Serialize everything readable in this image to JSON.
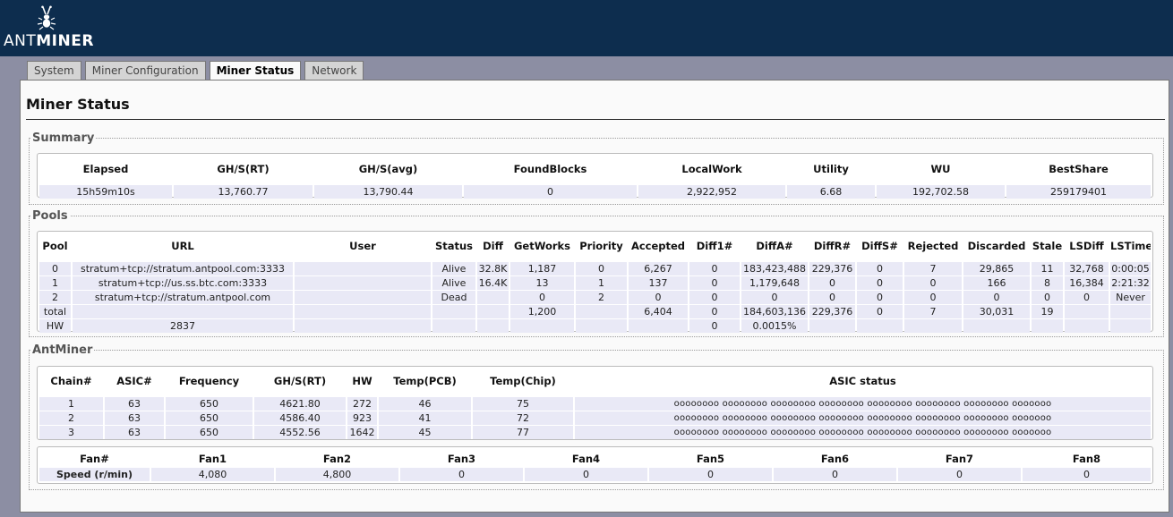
{
  "brand": {
    "prefix": "ANT",
    "suffix": "MINER"
  },
  "tabs": [
    {
      "label": "System",
      "active": false
    },
    {
      "label": "Miner Configuration",
      "active": false
    },
    {
      "label": "Miner Status",
      "active": true
    },
    {
      "label": "Network",
      "active": false
    }
  ],
  "page_title": "Miner Status",
  "summary": {
    "legend": "Summary",
    "headers": [
      "Elapsed",
      "GH/S(RT)",
      "GH/S(avg)",
      "FoundBlocks",
      "LocalWork",
      "Utility",
      "WU",
      "BestShare"
    ],
    "values": [
      "15h59m10s",
      "13,760.77",
      "13,790.44",
      "0",
      "2,922,952",
      "6.68",
      "192,702.58",
      "259179401"
    ]
  },
  "pools": {
    "legend": "Pools",
    "headers": [
      "Pool",
      "URL",
      "User",
      "Status",
      "Diff",
      "GetWorks",
      "Priority",
      "Accepted",
      "Diff1#",
      "DiffA#",
      "DiffR#",
      "DiffS#",
      "Rejected",
      "Discarded",
      "Stale",
      "LSDiff",
      "LSTime"
    ],
    "rows": [
      [
        "0",
        "stratum+tcp://stratum.antpool.com:3333",
        "",
        "Alive",
        "32.8K",
        "1,187",
        "0",
        "6,267",
        "0",
        "183,423,488",
        "229,376",
        "0",
        "7",
        "29,865",
        "11",
        "32,768",
        "0:00:05"
      ],
      [
        "1",
        "stratum+tcp://us.ss.btc.com:3333",
        "",
        "Alive",
        "16.4K",
        "13",
        "1",
        "137",
        "0",
        "1,179,648",
        "0",
        "0",
        "0",
        "166",
        "8",
        "16,384",
        "2:21:32"
      ],
      [
        "2",
        "stratum+tcp://stratum.antpool.com",
        "",
        "Dead",
        "",
        "0",
        "2",
        "0",
        "0",
        "0",
        "0",
        "0",
        "0",
        "0",
        "0",
        "0",
        "Never"
      ],
      [
        "total",
        "",
        "",
        "",
        "",
        "1,200",
        "",
        "6,404",
        "0",
        "184,603,136",
        "229,376",
        "0",
        "7",
        "30,031",
        "19",
        "",
        ""
      ]
    ],
    "hw_row": {
      "label": "HW",
      "value": "2837",
      "diff1": "0",
      "diffa": "0.0015%"
    }
  },
  "antminer": {
    "legend": "AntMiner",
    "chain_headers": [
      "Chain#",
      "ASIC#",
      "Frequency",
      "GH/S(RT)",
      "HW",
      "Temp(PCB)",
      "Temp(Chip)",
      "ASIC status"
    ],
    "chains": [
      [
        "1",
        "63",
        "650",
        "4621.80",
        "272",
        "46",
        "75",
        "oooooooo oooooooo oooooooo oooooooo oooooooo oooooooo oooooooo ooooooo"
      ],
      [
        "2",
        "63",
        "650",
        "4586.40",
        "923",
        "41",
        "72",
        "oooooooo oooooooo oooooooo oooooooo oooooooo oooooooo oooooooo ooooooo"
      ],
      [
        "3",
        "63",
        "650",
        "4552.56",
        "1642",
        "45",
        "77",
        "oooooooo oooooooo oooooooo oooooooo oooooooo oooooooo oooooooo ooooooo"
      ]
    ],
    "fan_headers": [
      "Fan#",
      "Fan1",
      "Fan2",
      "Fan3",
      "Fan4",
      "Fan5",
      "Fan6",
      "Fan7",
      "Fan8"
    ],
    "fan_row_label": "Speed (r/min)",
    "fan_speeds": [
      "4,080",
      "4,800",
      "0",
      "0",
      "0",
      "0",
      "0",
      "0"
    ]
  },
  "colors": {
    "header_bg": "#0d2d4e",
    "page_bg": "#8c8ea3",
    "cell_bg": "#e9e9f6"
  }
}
